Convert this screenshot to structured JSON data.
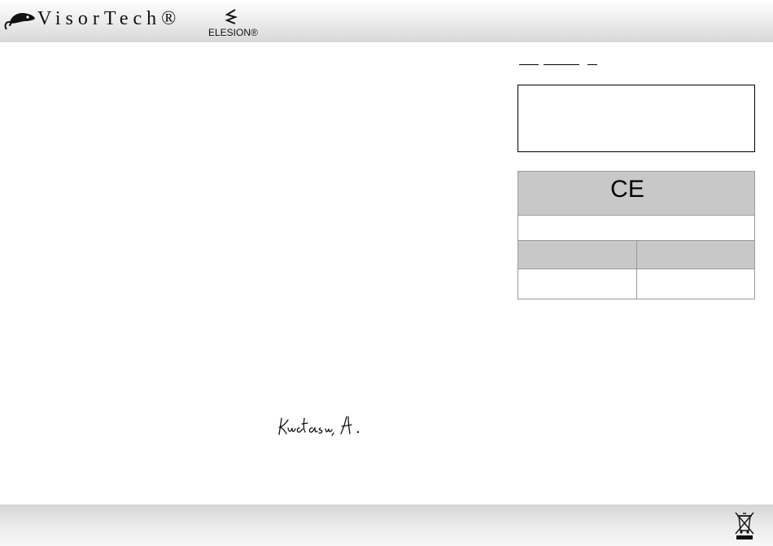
{
  "header": {
    "brand_primary": {
      "name": "VisorTech®",
      "icon": "chameleon-logo-icon"
    },
    "brand_secondary": {
      "name": "ELESION®",
      "icon": "elesion-logo-icon"
    }
  },
  "conformity": {
    "mark": "CE",
    "mark_icon": "ce-mark-icon"
  },
  "signature": {
    "icon": "handwritten-signature"
  },
  "footer": {
    "disposal_icon": "weee-crossed-bin-icon"
  },
  "colors": {
    "table_grey": "#c8c8c8",
    "header_grey": "#d8d8d8",
    "border": "#000000"
  }
}
